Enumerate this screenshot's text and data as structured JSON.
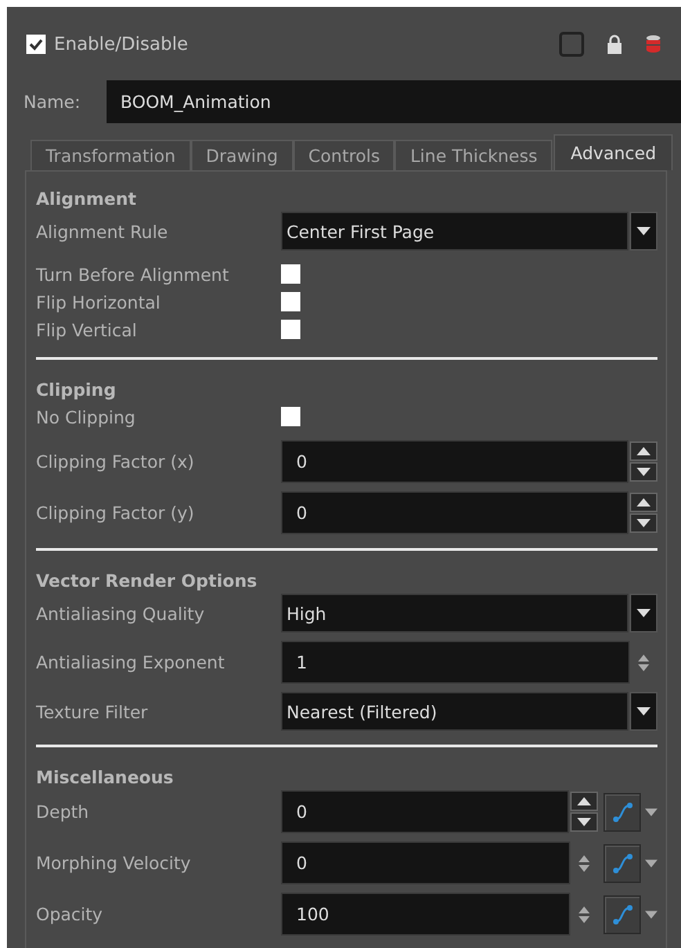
{
  "enable": {
    "label": "Enable/Disable",
    "checked": true
  },
  "name": {
    "label": "Name:",
    "value": "BOOM_Animation"
  },
  "tabs": [
    {
      "label": "Transformation",
      "selected": false
    },
    {
      "label": "Drawing",
      "selected": false
    },
    {
      "label": "Controls",
      "selected": false
    },
    {
      "label": "Line Thickness",
      "selected": false
    },
    {
      "label": "Advanced",
      "selected": true
    }
  ],
  "sections": [
    {
      "title": "Alignment",
      "rows": [
        {
          "kind": "dropdown",
          "label": "Alignment Rule",
          "value": "Center First Page"
        },
        {
          "kind": "checkbox",
          "label": "Turn Before Alignment",
          "checked": false
        },
        {
          "kind": "checkbox",
          "label": "Flip Horizontal",
          "checked": false
        },
        {
          "kind": "checkbox",
          "label": "Flip Vertical",
          "checked": false
        }
      ]
    },
    {
      "title": "Clipping",
      "rows": [
        {
          "kind": "checkbox",
          "label": "No Clipping",
          "checked": false
        },
        {
          "kind": "spin",
          "label": "Clipping Factor (x)",
          "value": "0",
          "function": false
        },
        {
          "kind": "spin",
          "label": "Clipping Factor (y)",
          "value": "0",
          "function": false
        }
      ]
    },
    {
      "title": "Vector Render Options",
      "rows": [
        {
          "kind": "dropdown",
          "label": "Antialiasing Quality",
          "value": "High"
        },
        {
          "kind": "stepper",
          "label": "Antialiasing Exponent",
          "value": "1",
          "function": false
        },
        {
          "kind": "dropdown",
          "label": "Texture Filter",
          "value": "Nearest (Filtered)"
        }
      ]
    },
    {
      "title": "Miscellaneous",
      "rows": [
        {
          "kind": "spin",
          "label": "Depth",
          "value": "0",
          "function": true
        },
        {
          "kind": "stepper",
          "label": "Morphing Velocity",
          "value": "0",
          "function": true
        },
        {
          "kind": "stepper",
          "label": "Opacity",
          "value": "100",
          "function": true
        }
      ]
    }
  ]
}
